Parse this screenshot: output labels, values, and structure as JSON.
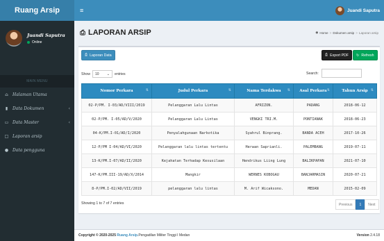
{
  "app": {
    "logo": "Ruang Arsip"
  },
  "navbar": {
    "toggle_icon": "hamburger-icon",
    "user_name": "Juandi Saputra"
  },
  "sidebar": {
    "user": {
      "name": "Juandi Saputra",
      "status": "Online"
    },
    "menu_header": "MAIN MENU",
    "items": [
      {
        "label": "Halaman Utama",
        "icon": "home-icon",
        "has_children": false
      },
      {
        "label": "Data Dokumen",
        "icon": "book-icon",
        "has_children": true
      },
      {
        "label": "Data Master",
        "icon": "monitor-icon",
        "has_children": true
      },
      {
        "label": "Laporan arsip",
        "icon": "file-icon",
        "has_children": false
      },
      {
        "label": "Data pengguna",
        "icon": "users-icon",
        "has_children": false
      }
    ]
  },
  "header": {
    "title": "LAPORAN ARSIP",
    "breadcrumb": {
      "home": "Home",
      "section": "Dokumen arsip",
      "current": "Laporan arsip"
    }
  },
  "toolbar": {
    "print_label": "Laporan Data",
    "pdf_label": "Export PDF",
    "refresh_label": "Refresh"
  },
  "table_controls": {
    "show_label": "Show",
    "entries_value": "10",
    "entries_label": "entries",
    "search_label": "Search:"
  },
  "table": {
    "columns": [
      "Nomor Perkara",
      "Judul Perkara",
      "Nama Terdakwa",
      "Asal Perkara",
      "Tahun Arsip"
    ],
    "rows": [
      [
        "02-P/PM. I-03/AD/VIII/2019",
        "Pelanggaran Lalu Lintas",
        "AFRIZON.",
        "PADANG",
        "2018-06-12"
      ],
      [
        "02-P/PM. I-05/AD/V/2020",
        "Pelanggaran Lalu Lintas",
        "VENGKI TRI.M.",
        "PONTIANAK",
        "2018-06-23"
      ],
      [
        "04-K/PM.I-01/AD/I/2020",
        "Penyalahgunaan Narkotika",
        "Syahrul Binprang.",
        "BANDA ACEH",
        "2017-10-26"
      ],
      [
        "12-P/PM I-04/AD/VI/2020",
        "Pelanggaran lalu lintas tertentu",
        "Herwan Saprianli.",
        "PALEMBANG",
        "2019-07-11"
      ],
      [
        "13-K/PM.I-07/AD/II/2020",
        "Kejahatan Terhadap Kesusilaan",
        "Hendrikus Liing Lung",
        "BALIKPAPAN",
        "2021-07-10"
      ],
      [
        "147-K/PM.III-19/AD/X/2014",
        "Mangkir",
        "WERNES KOBOGAU",
        "BANJARMASIN",
        "2020-07-21"
      ],
      [
        "8-P/PM.I-02/AD/VII/2019",
        "pelanggaran lalu lintas",
        "M. Arif Wicaksono.",
        "MEDAN",
        "2015-02-09"
      ]
    ]
  },
  "table_info": "Showing 1 to 7 of 7 entries",
  "pagination": {
    "previous": "Previous",
    "current": "1",
    "next": "Next"
  },
  "footer": {
    "copyright": "Copyright © 2020-2025",
    "brand": "Ruang Arsip.",
    "org": "Pengadilan Militer Tinggi I Medan",
    "version_label": "Version",
    "version": "2.4.18"
  },
  "colors": {
    "navbar": "#3c8dbc",
    "logo_bar": "#367fa9",
    "sidebar": "#222d32",
    "table_header": "#2d8bc0",
    "refresh": "#00a65a"
  }
}
